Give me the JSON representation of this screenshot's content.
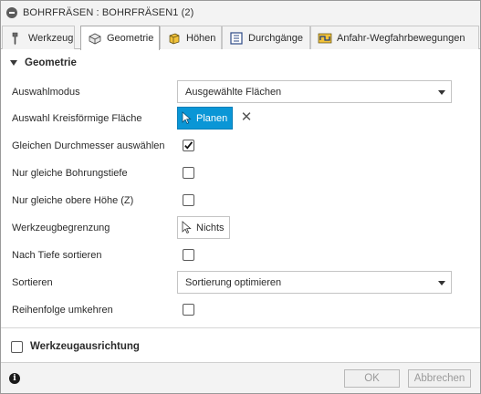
{
  "window": {
    "title": "BOHRFRÄSEN : BOHRFRÄSEN1 (2)"
  },
  "tabs": [
    {
      "label": "Werkzeug",
      "icon": "tool-icon"
    },
    {
      "label": "Geometrie",
      "icon": "geometry-icon"
    },
    {
      "label": "Höhen",
      "icon": "heights-icon"
    },
    {
      "label": "Durchgänge",
      "icon": "passes-icon"
    },
    {
      "label": "Anfahr-Wegfahrbewegungen",
      "icon": "linking-icon"
    }
  ],
  "active_tab": "Geometrie",
  "section": {
    "title": "Geometrie",
    "expanded": true
  },
  "fields": {
    "auswahlmodus": {
      "label": "Auswahlmodus",
      "value": "Ausgewählte Flächen"
    },
    "kreisflaeche": {
      "label": "Auswahl Kreisförmige Fläche",
      "button": "Planen",
      "clear": "✕"
    },
    "gleicher_durchmesser": {
      "label": "Gleichen Durchmesser auswählen",
      "checked": true
    },
    "gleiche_bohrungstiefe": {
      "label": "Nur gleiche Bohrungstiefe",
      "checked": false
    },
    "gleiche_obere_hoehe": {
      "label": "Nur gleiche obere Höhe (Z)",
      "checked": false
    },
    "werkzeugbegrenzung": {
      "label": "Werkzeugbegrenzung",
      "button": "Nichts"
    },
    "nach_tiefe": {
      "label": "Nach Tiefe sortieren",
      "checked": false
    },
    "sortieren": {
      "label": "Sortieren",
      "value": "Sortierung optimieren"
    },
    "reihenfolge": {
      "label": "Reihenfolge umkehren",
      "checked": false
    }
  },
  "section2": {
    "title": "Werkzeugausrichtung",
    "checked": false
  },
  "footer": {
    "info": "i",
    "ok": "OK",
    "cancel": "Abbrechen"
  },
  "colors": {
    "accent": "#0a96d6",
    "background": "#f3f3f3",
    "panel": "#ffffff"
  }
}
